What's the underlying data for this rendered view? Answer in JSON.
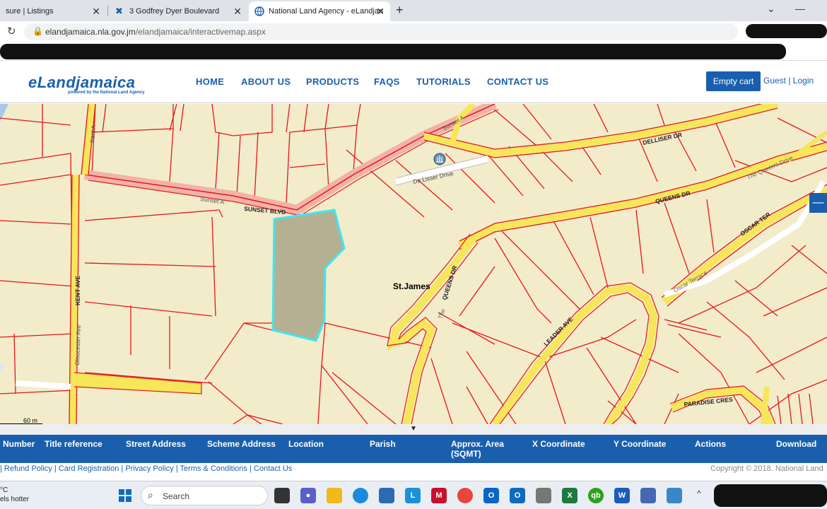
{
  "browser": {
    "tabs": [
      {
        "label": "sure | Listings",
        "active": false
      },
      {
        "label": "3 Godfrey Dyer Boulevard",
        "active": false
      },
      {
        "label": "National Land Agency - eLandjan",
        "active": true
      }
    ],
    "new_tab_glyph": "+",
    "url_host": "elandjamaica.nla.gov.jm",
    "url_path": "/elandjamaica/interactivemap.aspx"
  },
  "site": {
    "logo_text": "eLandjamaica",
    "logo_subtext": "powered by the National Land Agency",
    "nav": [
      "HOME",
      "ABOUT US",
      "PRODUCTS",
      "FAQS",
      "TUTORIALS",
      "CONTACT US"
    ],
    "cart_button": "Empty cart",
    "login_text": "Guest | Login"
  },
  "map": {
    "labels": {
      "sunset_blvd": "SUNSET BLVD",
      "sunset_a_upper": "Sunset A",
      "sunset_a_lower": "Sunset A",
      "delisser_dr": "DELLISER DR",
      "de_lisser_drive": "De Lisser Drive",
      "queens_dr": "QUEENS DR",
      "the_queens_drive_ne": "The Queen's Drive",
      "oscar_ter": "OSCAR TER",
      "oscar_terrace": "Oscar Terrace",
      "leader_ave": "LEADER AVE",
      "paradise_cres": "PARADISE CRES",
      "kent_ave": "KENT AVE",
      "kent_a": "Kent A",
      "gloucester_ave": "Gloucester Ave",
      "queens_dr_vertical": "QUEENS DR",
      "the_queens_vertical": "The",
      "st_james": "St.James",
      "scale": "60 m"
    },
    "zoom_out_glyph": "—"
  },
  "results": {
    "collapse_glyph": "▼",
    "columns": [
      "Number",
      "Title reference",
      "Street Address",
      "Scheme Address",
      "Location",
      "Parish",
      "Approx. Area (SQMT)",
      "X Coordinate",
      "Y Coordinate",
      "Actions",
      "Download"
    ]
  },
  "footer": {
    "links": "| Refund Policy | Card Registration | Privacy Policy | Terms & Conditions | Contact Us",
    "copyright": "Copyright © 2018. National Land"
  },
  "taskbar": {
    "weather_line1": "°C",
    "weather_line2": "els hotter",
    "search_placeholder": "Search",
    "tray_chevron": "^"
  },
  "colors": {
    "brand_blue": "#1a5fae",
    "map_bg": "#f2ecca",
    "parcel_line": "#e8141c",
    "road_fill": "#f6e65a",
    "selected_parcel": "#b5b092",
    "selected_outline": "#3ee7f0"
  }
}
